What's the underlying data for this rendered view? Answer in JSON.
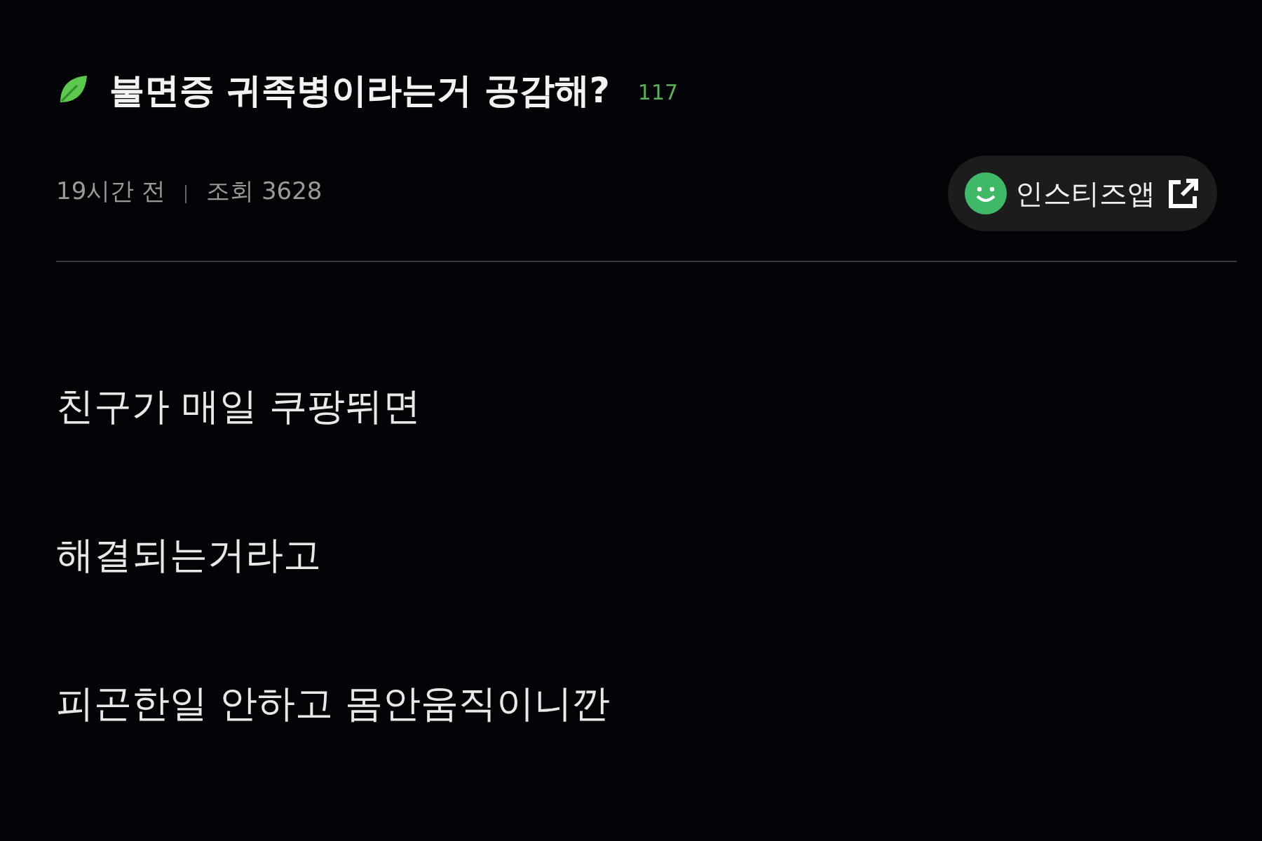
{
  "post": {
    "title": "불면증 귀족병이라는거 공감해?",
    "comment_count": "117",
    "time": "19시간 전",
    "views": "조회 3628",
    "app_button": {
      "label": "인스티즈앱"
    }
  },
  "body": [
    "친구가 매일 쿠팡뛰면",
    "해결되는거라고",
    "피곤한일 안하고 몸안움직이니깐"
  ]
}
